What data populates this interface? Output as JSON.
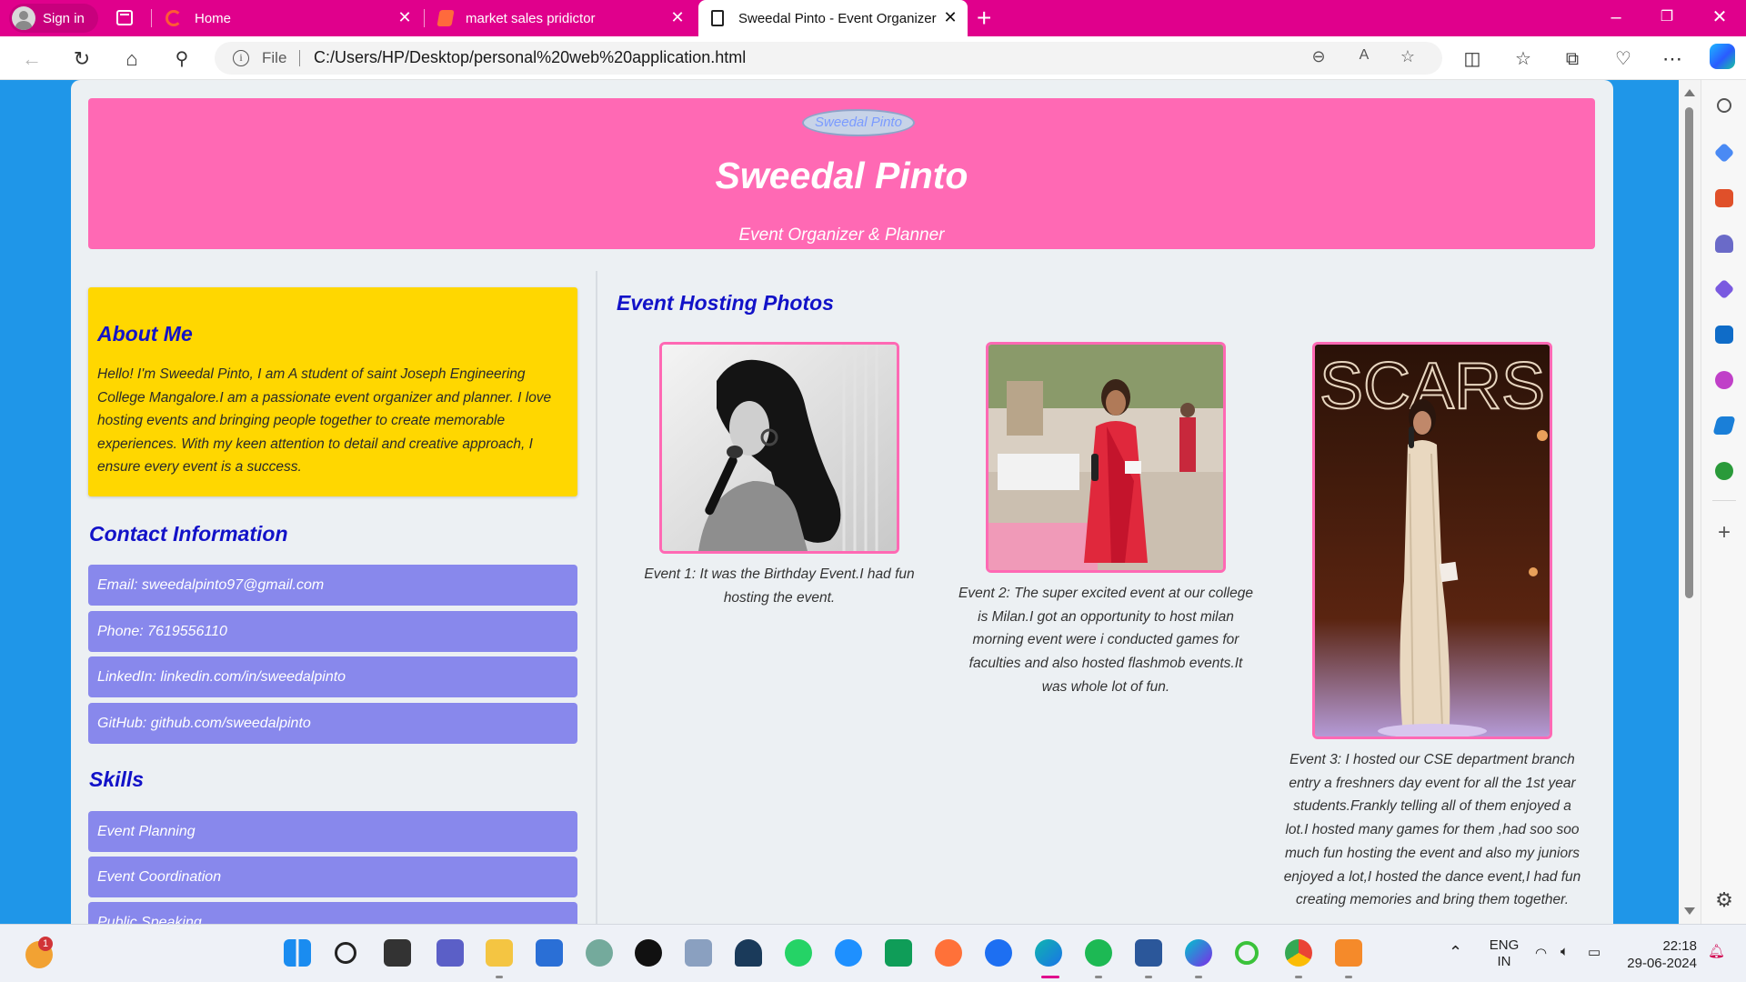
{
  "browser": {
    "profile_label": "Sign in",
    "tabs": [
      {
        "title": "Home",
        "icon": "edge-home-icon"
      },
      {
        "title": "market sales pridictor",
        "icon": "microsoft-start-icon"
      },
      {
        "title": "Sweedal Pinto - Event Organizer",
        "icon": "page-icon",
        "active": true
      }
    ],
    "address": {
      "scheme_label": "File",
      "url": "C:/Users/HP/Desktop/personal%20web%20application.html"
    }
  },
  "site": {
    "logo_text": "Sweedal Pinto",
    "name": "Sweedal Pinto",
    "tagline": "Event Organizer & Planner",
    "about": {
      "title": "About Me",
      "text": "Hello! I'm Sweedal Pinto, I am A student of saint Joseph Engineering College Mangalore.I am a passionate event organizer and planner. I love hosting events and bringing people together to create memorable experiences. With my keen attention to detail and creative approach, I ensure every event is a success."
    },
    "contact": {
      "title": "Contact Information",
      "items": [
        "Email: sweedalpinto97@gmail.com",
        "Phone: 7619556110",
        "LinkedIn: linkedin.com/in/sweedalpinto",
        "GitHub: github.com/sweedalpinto"
      ]
    },
    "skills": {
      "title": "Skills",
      "items": [
        "Event Planning",
        "Event Coordination",
        "Public Speaking"
      ]
    },
    "photos": {
      "title": "Event Hosting Photos",
      "items": [
        {
          "caption": "Event 1: It was the Birthday Event.I had fun hosting the event."
        },
        {
          "caption": "Event 2: The super excited event at our college is Milan.I got an opportunity to host milan morning event were i conducted games for faculties and also hosted flashmob events.It was whole lot of fun."
        },
        {
          "caption": "Event 3: I hosted our CSE department branch entry a freshners day event for all the 1st year students.Frankly telling all of them enjoyed a lot.I hosted many games for them ,had soo soo much fun hosting the event and also my juniors enjoyed a lot,I hosted the dance event,I had fun creating memories and bring them together."
        }
      ],
      "stage_sign_text": "SCARS"
    }
  },
  "taskbar": {
    "weather_badge": "1",
    "lang_top": "ENG",
    "lang_bottom": "IN",
    "time": "22:18",
    "date": "29-06-2024"
  }
}
